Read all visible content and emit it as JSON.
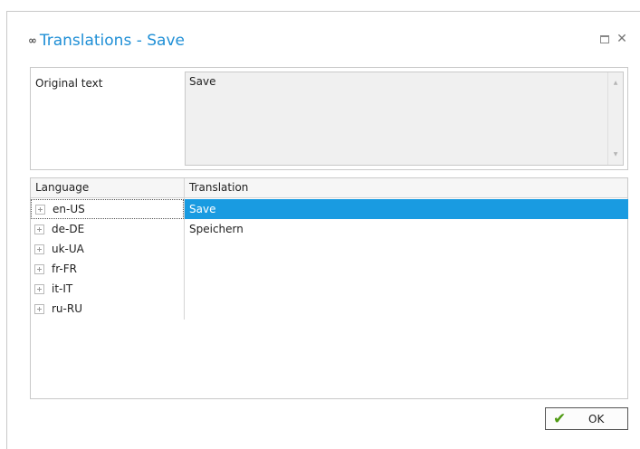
{
  "dialog": {
    "title": "Translations - Save",
    "title_icon": "link-icon"
  },
  "original": {
    "label": "Original text",
    "value": "Save"
  },
  "grid": {
    "headers": {
      "language": "Language",
      "translation": "Translation"
    },
    "languages": [
      "en-US",
      "de-DE",
      "uk-UA",
      "fr-FR",
      "it-IT",
      "ru-RU"
    ],
    "translations": [
      "Save",
      "Speichern"
    ],
    "selected_index": 0
  },
  "buttons": {
    "ok_label": "OK"
  },
  "colors": {
    "title": "#1f8fd6",
    "selection": "#199be1",
    "ok_check": "#4e9a12"
  }
}
